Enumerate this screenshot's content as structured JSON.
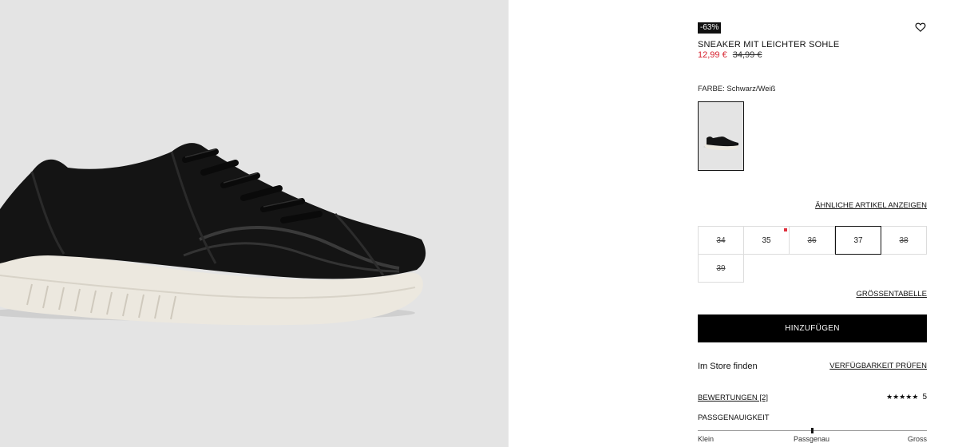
{
  "product": {
    "discount_badge": "-63%",
    "title": "SNEAKER MIT LEICHTER SOHLE",
    "price_current": "12,99 €",
    "price_old": "34,99 €",
    "color_label": "FARBE: Schwarz/Weiß",
    "similar_link": "ÄHNLICHE ARTIKEL ANZEIGEN"
  },
  "sizes": [
    {
      "label": "34",
      "available": false
    },
    {
      "label": "35",
      "available": true,
      "low_stock": true
    },
    {
      "label": "36",
      "available": false
    },
    {
      "label": "37",
      "available": true,
      "selected": true
    },
    {
      "label": "38",
      "available": false
    },
    {
      "label": "39",
      "available": false
    }
  ],
  "actions": {
    "size_table": "GRÖSSENTABELLE",
    "add_to_cart": "HINZUFÜGEN",
    "store_label": "Im Store finden",
    "availability_link": "VERFÜGBARKEIT PRÜFEN"
  },
  "reviews": {
    "link": "BEWERTUNGEN [2]",
    "stars": "★★★★★",
    "score": "5",
    "fit_label": "PASSGENAUIGKEIT",
    "fit_small": "Klein",
    "fit_true": "Passgenau",
    "fit_large": "Gross",
    "fit_value": 0.5
  },
  "colors": {
    "sale_red": "#d6202d",
    "gallery_bg": "#e4e4e4",
    "button_bg": "#000000"
  },
  "icons": {
    "wishlist": "heart-icon"
  }
}
